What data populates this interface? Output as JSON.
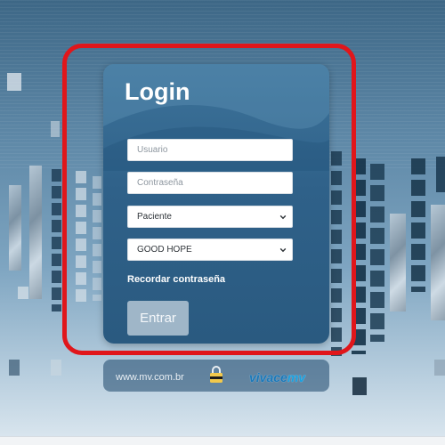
{
  "login": {
    "title": "Login",
    "username_placeholder": "Usuario",
    "password_placeholder": "Contraseña",
    "role_select": {
      "selected": "Paciente"
    },
    "hospital_select": {
      "selected": "GOOD HOPE"
    },
    "recover_link": "Recordar contraseña",
    "submit_label": "Entrar"
  },
  "footer": {
    "url": "www.mv.com.br",
    "brand_prefix": "vivace",
    "brand_suffix": "mv"
  },
  "icons": [
    "padlock-icon",
    "chevron-down-icon"
  ],
  "colors": {
    "highlight_border": "#e0161b",
    "panel": "#2f6189",
    "button": "#9fb6c8",
    "brand": "#1b78b8"
  }
}
